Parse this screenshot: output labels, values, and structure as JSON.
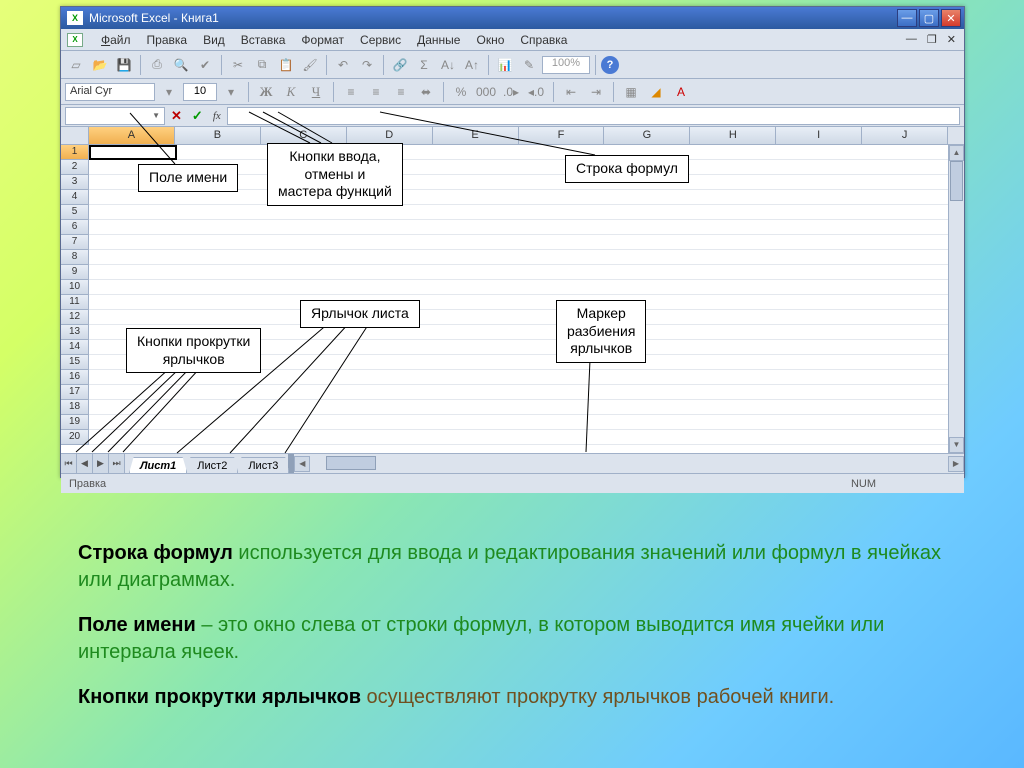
{
  "window": {
    "title": "Microsoft Excel - Книга1"
  },
  "menu": {
    "file": "Файл",
    "edit": "Правка",
    "view": "Вид",
    "insert": "Вставка",
    "format": "Формат",
    "tools": "Сервис",
    "data": "Данные",
    "window": "Окно",
    "help": "Справка"
  },
  "toolbar": {
    "zoom": "100%"
  },
  "format": {
    "font": "Arial Cyr",
    "size": "10",
    "bold": "Ж",
    "italic": "К",
    "underline": "Ч"
  },
  "formula": {
    "cancel": "✕",
    "enter": "✓",
    "fx": "fx"
  },
  "columns": [
    "A",
    "B",
    "C",
    "D",
    "E",
    "F",
    "G",
    "H",
    "I",
    "J"
  ],
  "rows": [
    "1",
    "2",
    "3",
    "4",
    "5",
    "6",
    "7",
    "8",
    "9",
    "10",
    "11",
    "12",
    "13",
    "14",
    "15",
    "16",
    "17",
    "18",
    "19",
    "20"
  ],
  "tabs": {
    "sheet1": "Лист1",
    "sheet2": "Лист2",
    "sheet3": "Лист3"
  },
  "status": {
    "mode": "Правка",
    "num": "NUM"
  },
  "callouts": {
    "namebox": "Поле имени",
    "fx_buttons": "Кнопки ввода,\nотмены и\nмастера функций",
    "formula_bar": "Строка формул",
    "sheet_tab": "Ярлычок листа",
    "tab_scroll": "Кнопки прокрутки\nярлычков",
    "split_marker": "Маркер\nразбиения\nярлычков"
  },
  "explain": {
    "p1_term": "Строка формул",
    "p1_body": " используется для ввода и редактирования значений или формул в ячейках или диаграммах.",
    "p2_term": "Поле имени",
    "p2_body": " – это окно слева от строки формул, в котором выводится имя ячейки или интервала ячеек.",
    "p3_term": "Кнопки прокрутки ярлычков",
    "p3_body": " осуществляют прокрутку ярлычков рабочей книги."
  }
}
